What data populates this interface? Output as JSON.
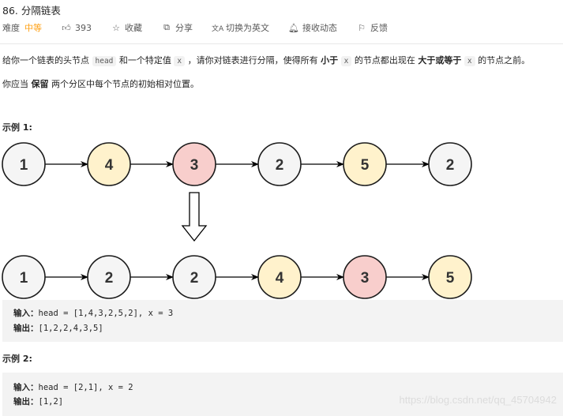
{
  "header": {
    "title": "86. 分隔链表",
    "difficulty_label": "难度",
    "difficulty_value": "中等",
    "difficulty_color": "#ffa116",
    "likes": "393",
    "actions": [
      {
        "icon": "thumbs-up-icon",
        "label": "393"
      },
      {
        "icon": "star-icon",
        "label": "收藏"
      },
      {
        "icon": "share-icon",
        "label": "分享"
      },
      {
        "icon": "translate-icon",
        "label": "切换为英文"
      },
      {
        "icon": "bell-icon",
        "label": "接收动态"
      },
      {
        "icon": "feedback-icon",
        "label": "反馈"
      }
    ]
  },
  "description": {
    "p1": {
      "t1": "给你一个链表的头节点 ",
      "code1": "head",
      "t2": " 和一个特定值 ",
      "code2": "x",
      "t3": " ，请你对链表进行分隔，使得所有 ",
      "b1": "小于",
      "t4": " ",
      "code3": "x",
      "t5": " 的节点都出现在 ",
      "b2": "大于或等于",
      "t6": " ",
      "code4": "x",
      "t7": " 的节点之前。"
    },
    "p2": {
      "t1": "你应当 ",
      "b1": "保留",
      "t2": " 两个分区中每个节点的初始相对位置。"
    }
  },
  "examples": [
    {
      "title": "示例 1:",
      "diagram": {
        "before": [
          {
            "value": "1",
            "color": "#f5f5f5"
          },
          {
            "value": "4",
            "color": "#fff2cc"
          },
          {
            "value": "3",
            "color": "#f8cecc"
          },
          {
            "value": "2",
            "color": "#f5f5f5"
          },
          {
            "value": "5",
            "color": "#fff2cc"
          },
          {
            "value": "2",
            "color": "#f5f5f5"
          }
        ],
        "after": [
          {
            "value": "1",
            "color": "#f5f5f5"
          },
          {
            "value": "2",
            "color": "#f5f5f5"
          },
          {
            "value": "2",
            "color": "#f5f5f5"
          },
          {
            "value": "4",
            "color": "#fff2cc"
          },
          {
            "value": "3",
            "color": "#f8cecc"
          },
          {
            "value": "5",
            "color": "#fff2cc"
          }
        ]
      },
      "input_label": "输入：",
      "input_value": "head = [1,4,3,2,5,2], x = 3",
      "output_label": "输出：",
      "output_value": "[1,2,2,4,3,5]"
    },
    {
      "title": "示例 2:",
      "input_label": "输入：",
      "input_value": "head = [2,1], x = 2",
      "output_label": "输出：",
      "output_value": "[1,2]"
    }
  ],
  "watermark": "https://blog.csdn.net/qq_45704942"
}
